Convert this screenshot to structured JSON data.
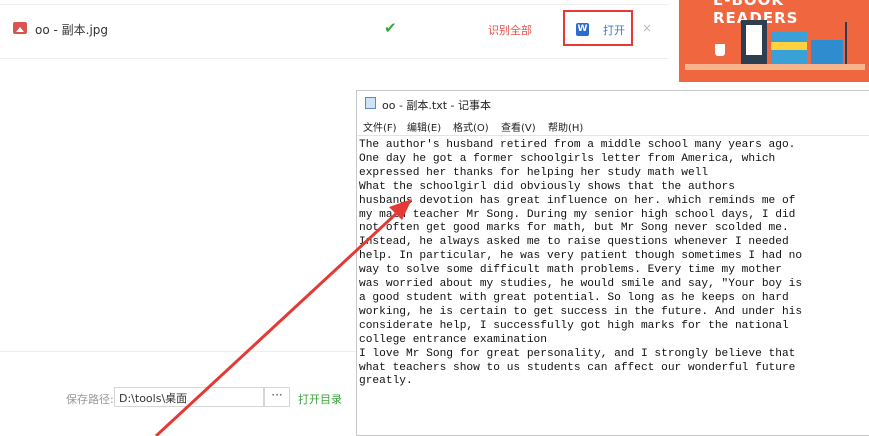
{
  "file_row": {
    "file_name": "oo - 副本.jpg",
    "recognize_label": "识别全部",
    "open_label": "打开",
    "close_label": "×",
    "check_icon": "check-icon",
    "word_icon_letter": "W"
  },
  "banner": {
    "text": "E-BOOK READERS"
  },
  "save": {
    "label": "保存路径:",
    "path": "D:\\tools\\桌面",
    "more_label": "···",
    "open_dir_label": "打开目录"
  },
  "notepad": {
    "title": "oo - 副本.txt - 记事本",
    "menu": [
      "文件(F)",
      "编辑(E)",
      "格式(O)",
      "查看(V)",
      "帮助(H)"
    ],
    "text": "The author's husband retired from a middle school many years ago.\nOne day he got a former schoolgirls letter from America, which\nexpressed her thanks for helping her study math well\nWhat the schoolgirl did obviously shows that the authors\nhusbands devotion has great influence on her. which reminds me of\nmy math teacher Mr Song. During my senior high school days, I did\nnot often get good marks for math, but Mr Song never scolded me.\nInstead, he always asked me to raise questions whenever I needed\nhelp. In particular, he was very patient though sometimes I had no\nway to solve some difficult math problems. Every time my mother\nwas worried about my studies, he would smile and say, \"Your boy is\na good student with great potential. So long as he keeps on hard\nworking, he is certain to get success in the future. And under his\nconsiderate help, I successfully got high marks for the national\ncollege entrance examination\nI love Mr Song for great personality, and I strongly believe that\nwhat teachers show to us students can affect our wonderful future\ngreatly."
  },
  "colors": {
    "accent_red": "#e53935",
    "link_blue": "#3a7bd5",
    "ok_green": "#3da33d",
    "banner_orange": "#f0663e"
  }
}
